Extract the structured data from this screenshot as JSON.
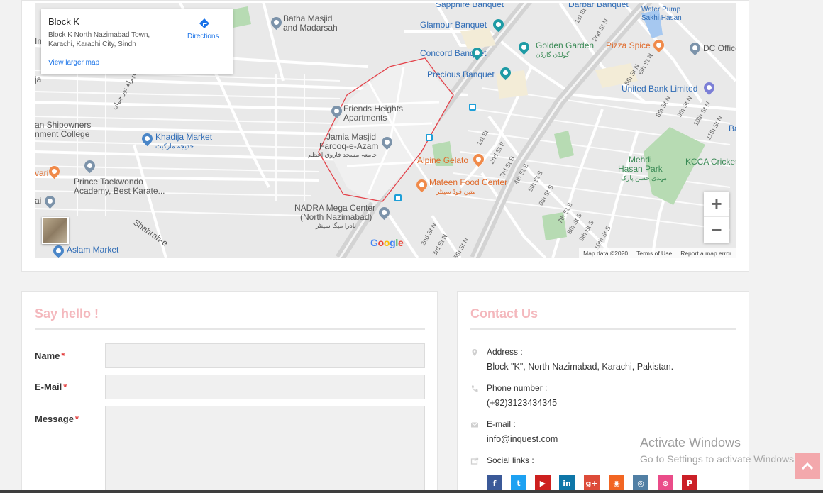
{
  "map": {
    "info": {
      "title": "Block K",
      "address": "Block K North Nazimabad Town, Karachi, Karachi City, Sindh",
      "directions": "Directions",
      "larger_map": "View larger map"
    },
    "places": [
      "Batha Masjid",
      "and Madarsah",
      "Glamour Banquet",
      "Golden Garden",
      "گولڈن گارڈن",
      "Pizza Spice",
      "DC Office",
      "Concord Banquet",
      "Precious Banquet",
      "United Bank Limited",
      "Friends Heights",
      "Apartments",
      "Khadija Market",
      "خدیجہ مارکیٹ",
      "an Shipowners",
      "nment College",
      "Jamia Masjid",
      "Farooq-e-Azam",
      "جامعہ مسجد فاروق اعظم",
      "Alpine Gelato",
      "Mehdi",
      "Hasan Park",
      "مہدی حسن پارک",
      "KCCA Cricket",
      "Prince Taekwondo",
      "Academy, Best Karate...",
      "Mateen Food Center",
      "متین فوڈ سینٹر",
      "NADRA Mega Center",
      "(North Nazimabad)",
      "نادرا میگا سینٹر",
      "Aslam Market",
      "Sapphire Banquet",
      "Darbar Banquet",
      "Water Pump",
      "Sakhi Hasan",
      "Shahrah-e",
      "شاہراہ نور جہاں",
      "vari",
      "Ba",
      "In",
      "ja",
      "ai"
    ],
    "streets": [
      "1st St",
      "2nd St N",
      "5th St N",
      "6th St N",
      "8th St N",
      "9th St N",
      "10th St N",
      "11th St N",
      "1st St",
      "2nd St S",
      "3rd St S",
      "4th St S",
      "5th St S",
      "6th St S",
      "7th St S",
      "8th St S",
      "9th St S",
      "10th St S",
      "2nd St N",
      "3rd St N",
      "5th St N"
    ],
    "zoom_in": "+",
    "zoom_out": "−",
    "google": "Google",
    "attribution": {
      "data": "Map data ©2020",
      "terms": "Terms of Use",
      "report": "Report a map error"
    }
  },
  "form": {
    "title": "Say hello !",
    "fields": [
      {
        "label": "Name",
        "required": "*"
      },
      {
        "label": "E-Mail",
        "required": "*"
      },
      {
        "label": "Message",
        "required": "*"
      }
    ]
  },
  "contact": {
    "title": "Contact Us",
    "address_label": "Address :",
    "address": "Block \"K\", North Nazimabad, Karachi, Pakistan.",
    "phone_label": "Phone number :",
    "phone": "(+92)3123434345",
    "email_label": "E-mail :",
    "email": "info@inquest.com",
    "social_label": "Social links :",
    "social": [
      {
        "name": "facebook",
        "glyph": "f",
        "color": "#3b5998"
      },
      {
        "name": "twitter",
        "glyph": "t",
        "color": "#1da1f2"
      },
      {
        "name": "youtube",
        "glyph": "▶",
        "color": "#cd201f"
      },
      {
        "name": "linkedin",
        "glyph": "in",
        "color": "#0e76a8"
      },
      {
        "name": "google-plus",
        "glyph": "g+",
        "color": "#dd4b39"
      },
      {
        "name": "rss",
        "glyph": "◉",
        "color": "#f26522"
      },
      {
        "name": "instagram",
        "glyph": "◎",
        "color": "#517fa4"
      },
      {
        "name": "dribbble",
        "glyph": "⊛",
        "color": "#ea4c89"
      },
      {
        "name": "pinterest",
        "glyph": "P",
        "color": "#cb2027"
      }
    ]
  },
  "watermark": {
    "line1": "Activate Windows",
    "line2": "Go to Settings to activate Windows."
  },
  "colors": {
    "accent": "#f4b8bd",
    "required": "#e23b3b"
  }
}
